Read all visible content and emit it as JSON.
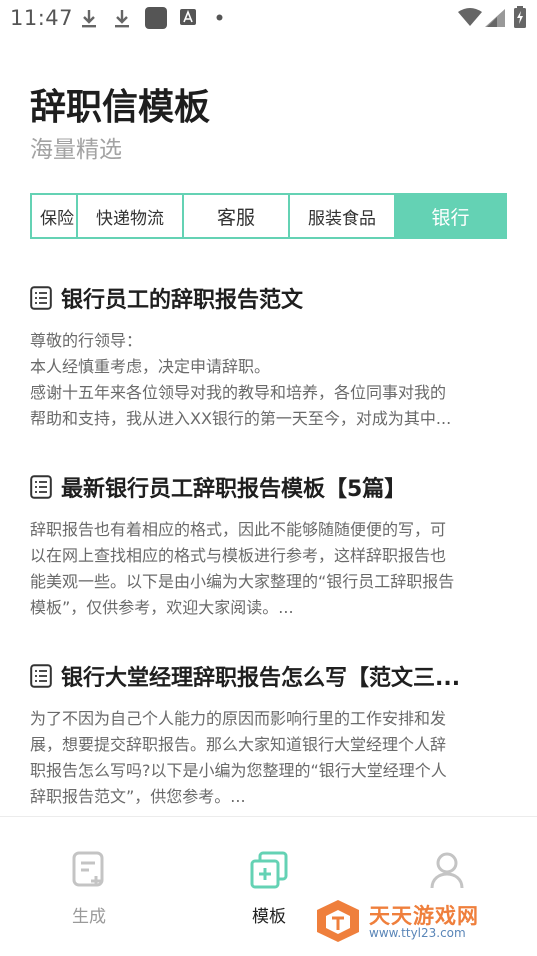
{
  "status": {
    "time": "11:47"
  },
  "header": {
    "title": "辞职信模板",
    "subtitle": "海量精选"
  },
  "tabs": [
    {
      "label": "保险"
    },
    {
      "label": "快递物流"
    },
    {
      "label": "客服"
    },
    {
      "label": "服装食品"
    },
    {
      "label": "银行"
    }
  ],
  "articles": [
    {
      "title": "银行员工的辞职报告范文",
      "body": [
        "尊敬的行领导：",
        "本人经慎重考虑，决定申请辞职。",
        "感谢十五年来各位领导对我的教导和培养，各位同事对我的",
        "帮助和支持，我从进入XX银行的第一天至今，对成为其中..."
      ]
    },
    {
      "title": "最新银行员工辞职报告模板【5篇】",
      "body": [
        "辞职报告也有着相应的格式，因此不能够随随便便的写，可",
        "以在网上查找相应的格式与模板进行参考，这样辞职报告也",
        "能美观一些。以下是由小编为大家整理的“银行员工辞职报告",
        "模板”，仅供参考，欢迎大家阅读。..."
      ]
    },
    {
      "title": "银行大堂经理辞职报告怎么写【范文三...",
      "body": [
        "为了不因为自己个人能力的原因而影响行里的工作安排和发",
        "展，想要提交辞职报告。那么大家知道银行大堂经理个人辞",
        "职报告怎么写吗?以下是小编为您整理的“银行大堂经理个人",
        "辞职报告范文”，供您参考。..."
      ]
    }
  ],
  "bottom_nav": [
    {
      "label": "生成",
      "icon": "generate-icon"
    },
    {
      "label": "模板",
      "icon": "template-icon"
    },
    {
      "label": "",
      "icon": "profile-icon"
    }
  ],
  "watermark": {
    "name": "天天游戏网",
    "url": "www.ttyl23.com"
  },
  "colors": {
    "accent": "#64d2b4",
    "watermark_orange": "#ef7f3c"
  }
}
